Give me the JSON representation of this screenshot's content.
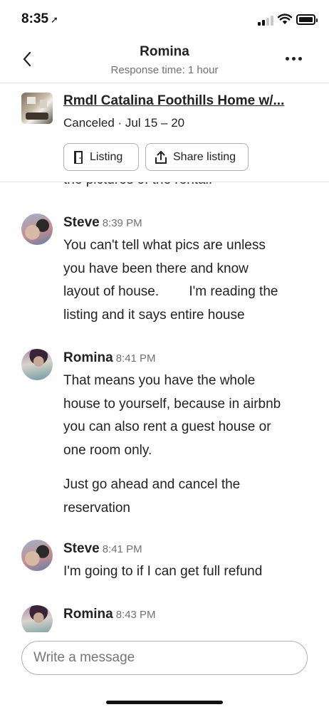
{
  "status_bar": {
    "time": "8:35",
    "location_icon": "location-arrow-icon",
    "signal_bars_active": 2,
    "signal_bars_total": 4,
    "battery_level": 1.0
  },
  "header": {
    "title": "Romina",
    "subtitle": "Response time: 1 hour",
    "back_icon": "chevron-left-icon",
    "more_icon": "more-horizontal-icon"
  },
  "listing": {
    "title": "Rmdl Catalina Foothills Home w/...",
    "status": "Canceled · Jul 15 – 20",
    "buttons": {
      "listing_label": "Listing",
      "share_label": "Share listing"
    }
  },
  "messages": {
    "cutoff_text": "the pictures of the rental.",
    "items": [
      {
        "sender": "Steve",
        "time": "8:39 PM",
        "paragraphs": [
          "You can't tell what pics are unless you have been there and know layout of house.        I'm reading the listing and it says entire house"
        ]
      },
      {
        "sender": "Romina",
        "time": "8:41 PM",
        "paragraphs": [
          "That means you have the whole house to yourself, because in airbnb you can also rent a guest house or one room only.",
          "Just go ahead and cancel the reservation"
        ]
      },
      {
        "sender": "Steve",
        "time": "8:41 PM",
        "paragraphs": [
          "I'm going to if I can get full refund"
        ]
      },
      {
        "sender": "Romina",
        "time": "8:43 PM",
        "paragraphs": [
          ""
        ]
      }
    ]
  },
  "composer": {
    "placeholder": "Write a message",
    "value": ""
  }
}
